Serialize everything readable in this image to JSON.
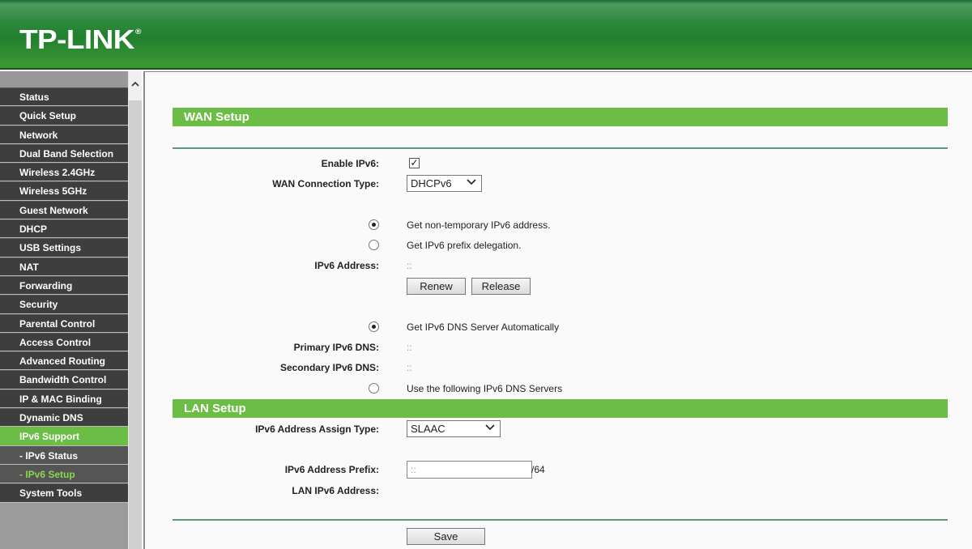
{
  "header": {
    "brand": "TP-LINK",
    "registered": "®"
  },
  "sidebar": {
    "items": [
      {
        "label": "Status"
      },
      {
        "label": "Quick Setup"
      },
      {
        "label": "Network"
      },
      {
        "label": "Dual Band Selection"
      },
      {
        "label": "Wireless 2.4GHz"
      },
      {
        "label": "Wireless 5GHz"
      },
      {
        "label": "Guest Network"
      },
      {
        "label": "DHCP"
      },
      {
        "label": "USB Settings"
      },
      {
        "label": "NAT"
      },
      {
        "label": "Forwarding"
      },
      {
        "label": "Security"
      },
      {
        "label": "Parental Control"
      },
      {
        "label": "Access Control"
      },
      {
        "label": "Advanced Routing"
      },
      {
        "label": "Bandwidth Control"
      },
      {
        "label": "IP & MAC Binding"
      },
      {
        "label": "Dynamic DNS"
      },
      {
        "label": "IPv6 Support"
      },
      {
        "label": "- IPv6 Status"
      },
      {
        "label": "- IPv6 Setup"
      },
      {
        "label": "System Tools"
      }
    ],
    "active": "IPv6 Support",
    "current_sub": "- IPv6 Setup"
  },
  "wan": {
    "title": "WAN Setup",
    "enable_ipv6_label": "Enable IPv6:",
    "enable_ipv6_checked": true,
    "conn_type_label": "WAN Connection Type:",
    "conn_type_value": "DHCPv6",
    "opt_nontemp": "Get non-temporary IPv6 address.",
    "opt_prefix": "Get IPv6 prefix delegation.",
    "ipv6_address_label": "IPv6 Address:",
    "ipv6_address_value": "::",
    "renew_label": "Renew",
    "release_label": "Release",
    "dns_auto_label": "Get IPv6 DNS Server Automatically",
    "primary_dns_label": "Primary IPv6 DNS:",
    "primary_dns_value": "::",
    "secondary_dns_label": "Secondary IPv6 DNS:",
    "secondary_dns_value": "::",
    "dns_manual_label": "Use the following IPv6 DNS Servers"
  },
  "lan": {
    "title": "LAN Setup",
    "assign_type_label": "IPv6 Address Assign Type:",
    "assign_type_value": "SLAAC",
    "prefix_label": "IPv6 Address Prefix:",
    "prefix_value": "::",
    "prefix_suffix": "/64",
    "lan_address_label": "LAN IPv6 Address:"
  },
  "save_label": "Save"
}
